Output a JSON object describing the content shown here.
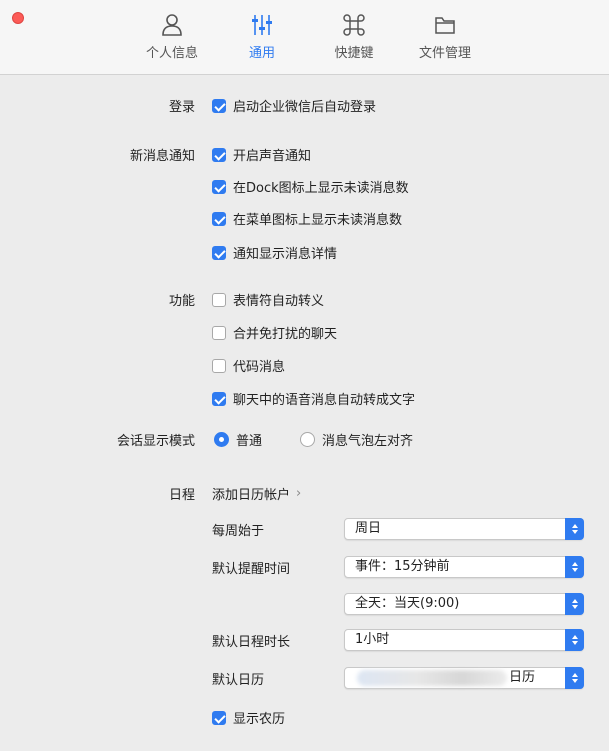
{
  "tabs": [
    {
      "label": "个人信息",
      "icon": "person-icon",
      "active": false
    },
    {
      "label": "通用",
      "icon": "sliders-icon",
      "active": true
    },
    {
      "label": "快捷键",
      "icon": "command-icon",
      "active": false
    },
    {
      "label": "文件管理",
      "icon": "folder-icon",
      "active": false
    }
  ],
  "accent": "#2f7bf0",
  "login": {
    "label": "登录",
    "option": "启动企业微信后自动登录",
    "checked": true
  },
  "notify": {
    "label": "新消息通知",
    "options": [
      {
        "text": "开启声音通知",
        "checked": true
      },
      {
        "text": "在Dock图标上显示未读消息数",
        "checked": true
      },
      {
        "text": "在菜单图标上显示未读消息数",
        "checked": true
      },
      {
        "text": "通知显示消息详情",
        "checked": true
      }
    ]
  },
  "features": {
    "label": "功能",
    "options": [
      {
        "text": "表情符自动转义",
        "checked": false
      },
      {
        "text": "合并免打扰的聊天",
        "checked": false
      },
      {
        "text": "代码消息",
        "checked": false
      },
      {
        "text": "聊天中的语音消息自动转成文字",
        "checked": true
      }
    ]
  },
  "mode": {
    "label": "会话显示模式",
    "options": [
      {
        "text": "普通",
        "selected": true
      },
      {
        "text": "消息气泡左对齐",
        "selected": false
      }
    ]
  },
  "schedule": {
    "label": "日程",
    "add_account": "添加日历帐户",
    "chevron": "›",
    "week_start": {
      "label": "每周始于",
      "value": "周日"
    },
    "reminder": {
      "label": "默认提醒时间",
      "value": "事件：15分钟前",
      "value2": "全天：当天(9:00)"
    },
    "duration": {
      "label": "默认日程时长",
      "value": "1小时"
    },
    "calendar": {
      "label": "默认日历",
      "value": "日历"
    },
    "lunar": {
      "text": "显示农历",
      "checked": true
    }
  }
}
